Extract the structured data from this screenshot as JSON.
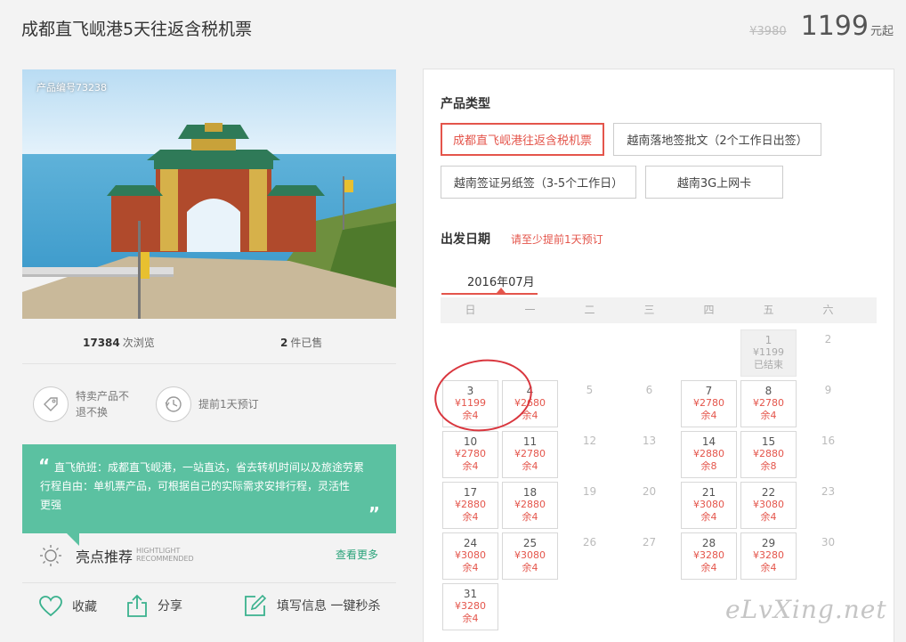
{
  "header": {
    "title": "成都直飞岘港5天往返含税机票",
    "old_price": "¥3980",
    "price": "1199",
    "price_unit": "元起"
  },
  "product": {
    "code": "产品编号73238",
    "views_count": "17384",
    "views_label": "次浏览",
    "sold_count": "2",
    "sold_label": "件已售"
  },
  "tags": [
    {
      "icon": "price-tag-icon",
      "text": "特卖产品不退不换"
    },
    {
      "icon": "clock-history-icon",
      "text": "提前1天预订"
    }
  ],
  "highlight": {
    "line1": "直飞航班：成都直飞岘港，一站直达，省去转机时间以及旅途劳累",
    "line2": "行程自由：单机票产品，可根据自己的实际需求安排行程，灵活性",
    "line3": "更强",
    "title": "亮点推荐",
    "sub1": "HIGHTLIGHT",
    "sub2": "RECOMMENDED",
    "more": "查看更多"
  },
  "actions": {
    "favorite": "收藏",
    "share": "分享",
    "fill": "填写信息 一键秒杀"
  },
  "booking": {
    "type_title": "产品类型",
    "options": [
      "成都直飞岘港往返含税机票",
      "越南落地签批文（2个工作日出签）",
      "越南签证另纸签（3-5个工作日）",
      "越南3G上网卡"
    ],
    "date_title": "出发日期",
    "date_note": "请至少提前1天预订",
    "month": "2016年07月",
    "weekdays": [
      "日",
      "一",
      "二",
      "三",
      "四",
      "五",
      "六"
    ]
  },
  "calendar": [
    {
      "day": "1",
      "price": "¥1199",
      "status": "已结束",
      "type": "ended"
    },
    {
      "day": "2",
      "type": "empty"
    },
    {
      "day": "3",
      "price": "¥1199",
      "status": "余4",
      "type": "avail"
    },
    {
      "day": "4",
      "price": "¥2680",
      "status": "余4",
      "type": "avail"
    },
    {
      "day": "5",
      "type": "empty"
    },
    {
      "day": "6",
      "type": "empty"
    },
    {
      "day": "7",
      "price": "¥2780",
      "status": "余4",
      "type": "avail"
    },
    {
      "day": "8",
      "price": "¥2780",
      "status": "余4",
      "type": "avail"
    },
    {
      "day": "9",
      "type": "empty"
    },
    {
      "day": "10",
      "price": "¥2780",
      "status": "余4",
      "type": "avail"
    },
    {
      "day": "11",
      "price": "¥2780",
      "status": "余4",
      "type": "avail"
    },
    {
      "day": "12",
      "type": "empty"
    },
    {
      "day": "13",
      "type": "empty"
    },
    {
      "day": "14",
      "price": "¥2880",
      "status": "余8",
      "type": "avail"
    },
    {
      "day": "15",
      "price": "¥2880",
      "status": "余8",
      "type": "avail"
    },
    {
      "day": "16",
      "type": "empty"
    },
    {
      "day": "17",
      "price": "¥2880",
      "status": "余4",
      "type": "avail"
    },
    {
      "day": "18",
      "price": "¥2880",
      "status": "余4",
      "type": "avail"
    },
    {
      "day": "19",
      "type": "empty"
    },
    {
      "day": "20",
      "type": "empty"
    },
    {
      "day": "21",
      "price": "¥3080",
      "status": "余4",
      "type": "avail"
    },
    {
      "day": "22",
      "price": "¥3080",
      "status": "余4",
      "type": "avail"
    },
    {
      "day": "23",
      "type": "empty"
    },
    {
      "day": "24",
      "price": "¥3080",
      "status": "余4",
      "type": "avail"
    },
    {
      "day": "25",
      "price": "¥3080",
      "status": "余4",
      "type": "avail"
    },
    {
      "day": "26",
      "type": "empty"
    },
    {
      "day": "27",
      "type": "empty"
    },
    {
      "day": "28",
      "price": "¥3280",
      "status": "余4",
      "type": "avail"
    },
    {
      "day": "29",
      "price": "¥3280",
      "status": "余4",
      "type": "avail"
    },
    {
      "day": "30",
      "type": "empty"
    },
    {
      "day": "31",
      "price": "¥3280",
      "status": "余4",
      "type": "avail"
    }
  ],
  "watermark": "eLvXing.net",
  "colors": {
    "accent": "#e4554b",
    "green": "#5bc1a1",
    "link": "#2aa37a"
  }
}
